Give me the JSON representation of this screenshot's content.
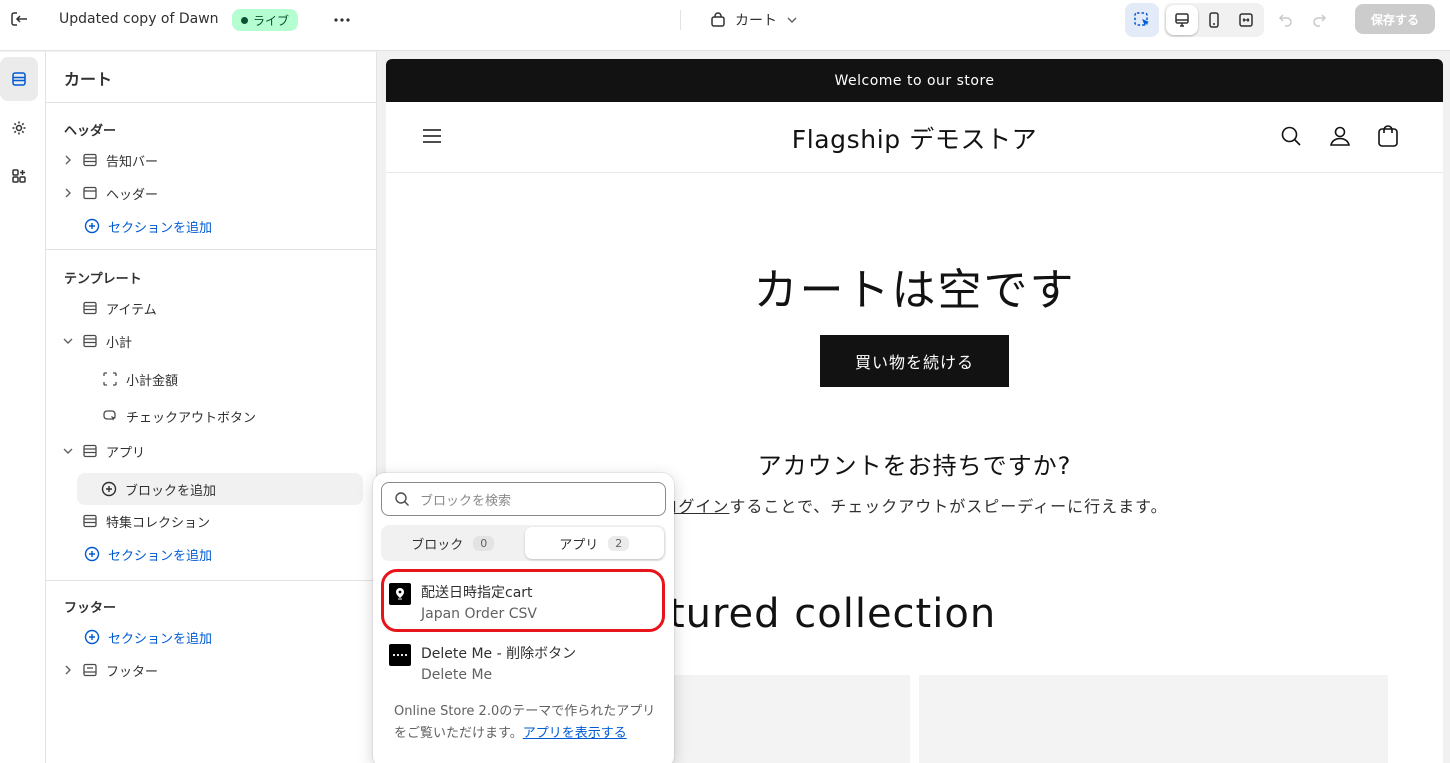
{
  "topbar": {
    "theme_name": "Updated copy of Dawn",
    "live_badge": "ライブ",
    "page_select": "カート",
    "save_label": "保存する"
  },
  "sidebar": {
    "title": "カート",
    "header_group": {
      "title": "ヘッダー",
      "items": [
        "告知バー",
        "ヘッダー"
      ],
      "add_section": "セクションを追加"
    },
    "template_group": {
      "title": "テンプレート",
      "items": [
        "アイテム",
        "小計",
        "小計金額",
        "チェックアウトボタン",
        "アプリ"
      ],
      "add_block": "ブロックを追加",
      "featured": "特集コレクション",
      "add_section": "セクションを追加"
    },
    "footer_group": {
      "title": "フッター",
      "add_section": "セクションを追加",
      "items": [
        "フッター"
      ]
    }
  },
  "preview": {
    "announcement": "Welcome to our store",
    "store_name": "Flagship デモストア",
    "empty_title": "カートは空です",
    "continue_button": "買い物を続ける",
    "account_title": "アカウントをお持ちですか?",
    "account_link": "ログイン",
    "account_text": "することで、チェックアウトがスピーディーに行えます。",
    "collection_title": "Featured collection"
  },
  "popover": {
    "search_placeholder": "ブロックを検索",
    "tabs": [
      {
        "label": "ブロック",
        "count": "0"
      },
      {
        "label": "アプリ",
        "count": "2"
      }
    ],
    "apps": [
      {
        "name": "配送日時指定cart",
        "vendor": "Japan Order CSV"
      },
      {
        "name": "Delete Me - 削除ボタン",
        "vendor": "Delete Me"
      }
    ],
    "note": "Online Store 2.0のテーマで作られたアプリをご覧いただけます。",
    "note_link": "アプリを表示する"
  },
  "colors": {
    "accent": "#005bd3",
    "highlight": "#e8141b",
    "live_badge_bg": "#b4fed2"
  }
}
